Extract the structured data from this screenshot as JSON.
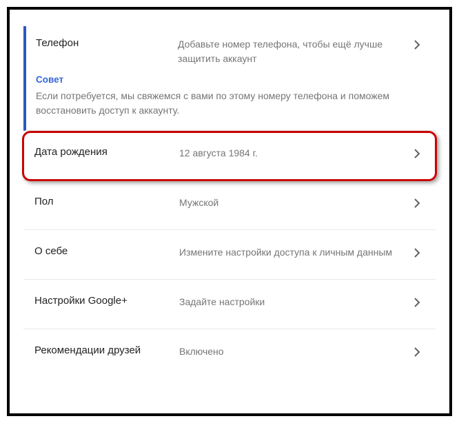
{
  "phone": {
    "title": "Телефон",
    "desc": "Добавьте номер телефона, чтобы ещё лучше защитить аккаунт",
    "tip_label": "Совет",
    "tip_text": "Если потребуется, мы свяжемся с вами по этому номеру телефона и поможем восстановить доступ к аккаунту."
  },
  "birthday": {
    "title": "Дата рождения",
    "value": "12 августа 1984 г."
  },
  "gender": {
    "title": "Пол",
    "value": "Мужской"
  },
  "about": {
    "title": "О себе",
    "value": "Измените настройки доступа к личным данным"
  },
  "gplus": {
    "title": "Настройки Google+",
    "value": "Задайте настройки"
  },
  "friends": {
    "title": "Рекомендации друзей",
    "value": "Включено"
  }
}
